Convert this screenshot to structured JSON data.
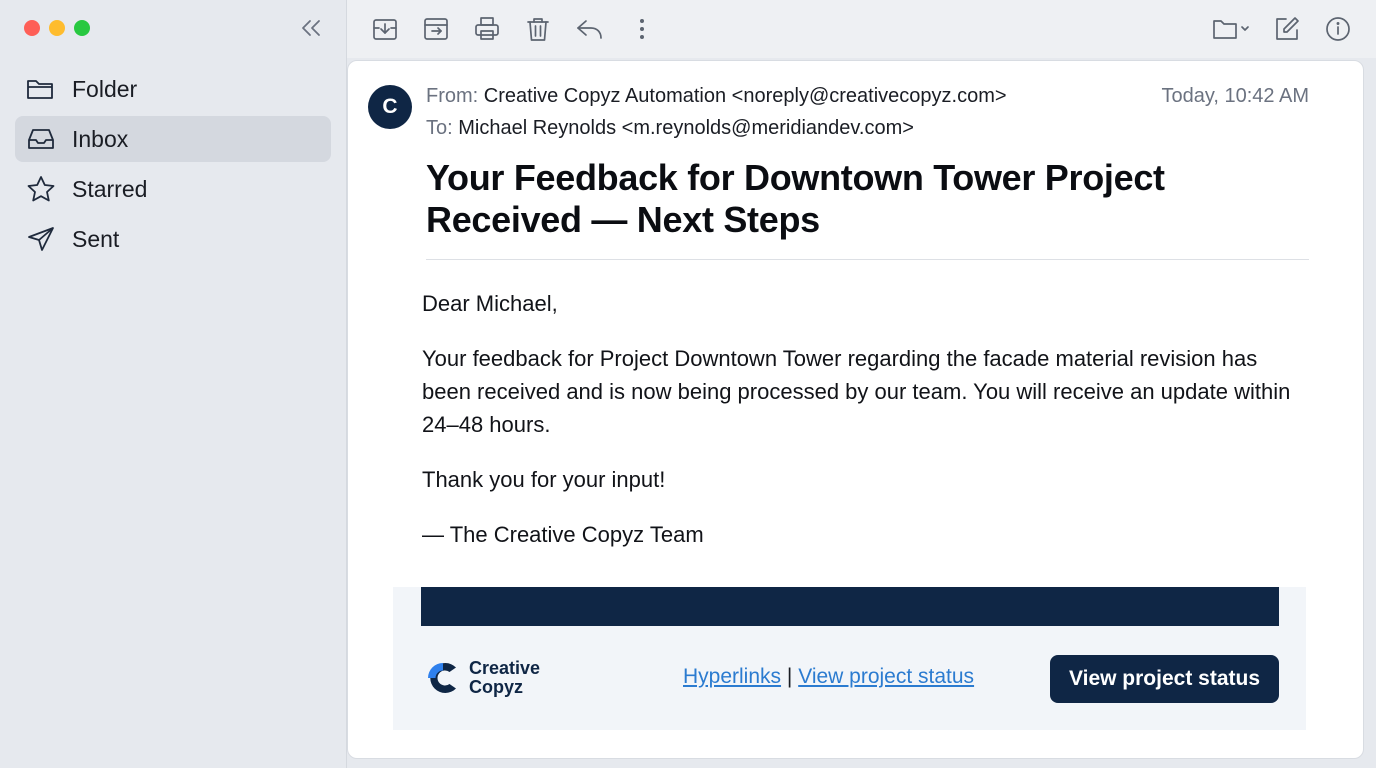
{
  "window": {
    "controls": [
      "close",
      "minimize",
      "zoom"
    ]
  },
  "sidebar": {
    "items": [
      {
        "label": "Folder",
        "icon": "folder-icon",
        "active": false
      },
      {
        "label": "Inbox",
        "icon": "inbox-icon",
        "active": true
      },
      {
        "label": "Starred",
        "icon": "star-icon",
        "active": false
      },
      {
        "label": "Sent",
        "icon": "send-icon",
        "active": false
      }
    ]
  },
  "toolbar": {
    "left_icons": [
      "archive-download-icon",
      "archive-box-icon",
      "print-icon",
      "trash-icon",
      "reply-icon",
      "more-vertical-icon"
    ],
    "right_icons": [
      "folder-dropdown-icon",
      "compose-icon",
      "info-icon"
    ]
  },
  "email": {
    "avatar_initial": "C",
    "from_label": "From:",
    "from_value": "Creative Copyz Automation <noreply@creativecopyz.com>",
    "to_label": "To:",
    "to_value": "Michael Reynolds <m.reynolds@meridiandev.com>",
    "date": "Today, 10:42 AM",
    "subject": "Your Feedback for Downtown Tower Project Received — Next Steps",
    "body": {
      "greeting": "Dear Michael,",
      "paragraph": "Your feedback for Project Downtown Tower regarding the facade material revision has been received and is now being processed by our team. You will receive an update within 24–48 hours.",
      "thanks": "Thank you for your input!",
      "signature": "— The Creative Copyz Team"
    },
    "footer": {
      "logo_line1": "Creative",
      "logo_line2": "Copyz",
      "link1": "Hyperlinks",
      "separator": "|",
      "link2": "View project status",
      "button": "View project status"
    }
  },
  "colors": {
    "navy": "#0f2645",
    "link": "#2b7bd0",
    "logo_accent": "#2f80ed",
    "sidebar_bg": "#e6e9ee",
    "active_item": "#d4d8df"
  }
}
